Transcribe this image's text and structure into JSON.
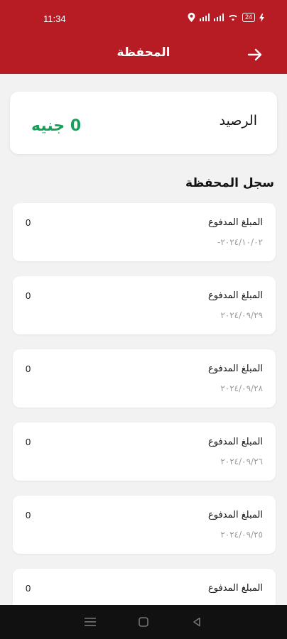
{
  "status_bar": {
    "time": "11:34",
    "battery": "24"
  },
  "app_bar": {
    "title": "المحفظة"
  },
  "balance": {
    "label": "الرصيد",
    "value": "0 جنيه"
  },
  "history": {
    "title": "سجل المحفظة",
    "items": [
      {
        "label": "المبلغ المدفوع",
        "amount": "0",
        "date": "٢٠٢٤/١٠/٠٢-"
      },
      {
        "label": "المبلغ المدفوع",
        "amount": "0",
        "date": "٢٠٢٤/٠٩/٢٩"
      },
      {
        "label": "المبلغ المدفوع",
        "amount": "0",
        "date": "٢٠٢٤/٠٩/٢٨"
      },
      {
        "label": "المبلغ المدفوع",
        "amount": "0",
        "date": "٢٠٢٤/٠٩/٢٦"
      },
      {
        "label": "المبلغ المدفوع",
        "amount": "0",
        "date": "٢٠٢٤/٠٩/٢٥"
      },
      {
        "label": "المبلغ المدفوع",
        "amount": "0",
        "date": ""
      }
    ]
  },
  "colors": {
    "brand": "#b71c24",
    "balance": "#18a05a"
  },
  "icons": {
    "back": "arrow-right-icon",
    "location": "location-pin-icon"
  }
}
